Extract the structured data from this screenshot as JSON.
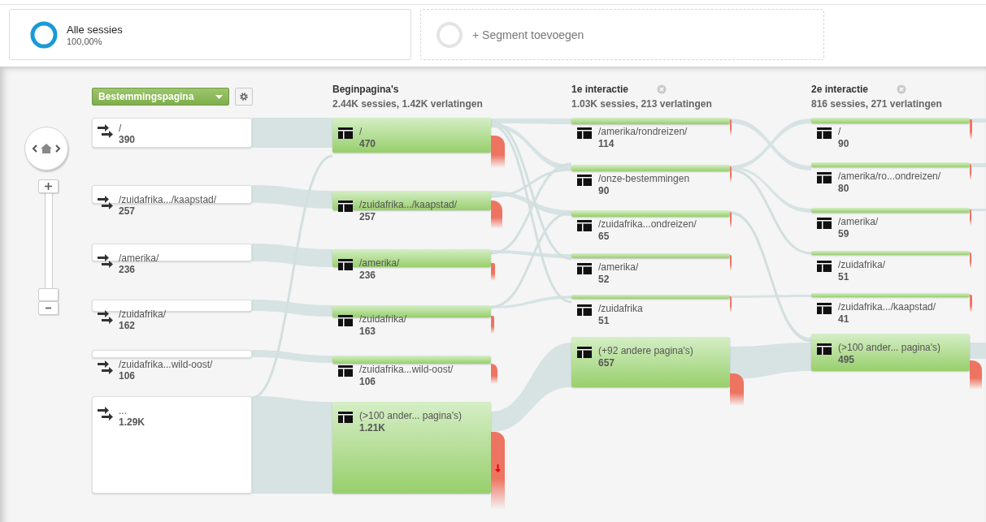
{
  "segments": [
    {
      "kind": "active",
      "label": "Alle sessies",
      "value": "100,00%"
    },
    {
      "kind": "add",
      "label": "+ Segment toevoegen"
    }
  ],
  "dimension_menu": {
    "label": "Bestemmingspagina"
  },
  "columns": [
    {
      "kind": "start",
      "nodes": [
        {
          "label": "/",
          "count": "390"
        },
        {
          "label": "/zuidafrika.../kaapstad/",
          "count": "257"
        },
        {
          "label": "/amerika/",
          "count": "236"
        },
        {
          "label": "/zuidafrika/",
          "count": "162"
        },
        {
          "label": "/zuidafrika...wild-oost/",
          "count": "106"
        },
        {
          "label": "...",
          "count": "1.29K"
        }
      ]
    },
    {
      "kind": "step",
      "title": "Beginpagina's",
      "summary": "2.44K sessies, 1.42K verlatingen",
      "nodes": [
        {
          "label": "/",
          "count": "470"
        },
        {
          "label": "/zuidafrika.../kaapstad/",
          "count": "257"
        },
        {
          "label": "/amerika/",
          "count": "236"
        },
        {
          "label": "/zuidafrika/",
          "count": "163"
        },
        {
          "label": "/zuidafrika...wild-oost/",
          "count": "106"
        },
        {
          "label": "(>100 ander... pagina's)",
          "count": "1.21K"
        }
      ]
    },
    {
      "kind": "step",
      "title": "1e interactie",
      "summary": "1.03K sessies, 213 verlatingen",
      "closable": true,
      "nodes": [
        {
          "label": "/amerika/rondreizen/",
          "count": "114"
        },
        {
          "label": "/onze-bestemmingen",
          "count": "90"
        },
        {
          "label": "/zuidafrika...ondreizen/",
          "count": "65"
        },
        {
          "label": "/amerika/",
          "count": "52"
        },
        {
          "label": "/zuidafrika",
          "count": "51"
        },
        {
          "label": "(+92 andere pagina's)",
          "count": "657"
        }
      ]
    },
    {
      "kind": "step",
      "title": "2e interactie",
      "summary": "816 sessies, 271 verlatingen",
      "closable": true,
      "nodes": [
        {
          "label": "/",
          "count": "90"
        },
        {
          "label": "/amerika/ro...ondreizen/",
          "count": "80"
        },
        {
          "label": "/amerika/",
          "count": "59"
        },
        {
          "label": "/zuidafrika/",
          "count": "51"
        },
        {
          "label": "/zuidafrika.../kaapstad/",
          "count": "41"
        },
        {
          "label": "(>100 ander... pagina's)",
          "count": "495"
        }
      ]
    }
  ]
}
